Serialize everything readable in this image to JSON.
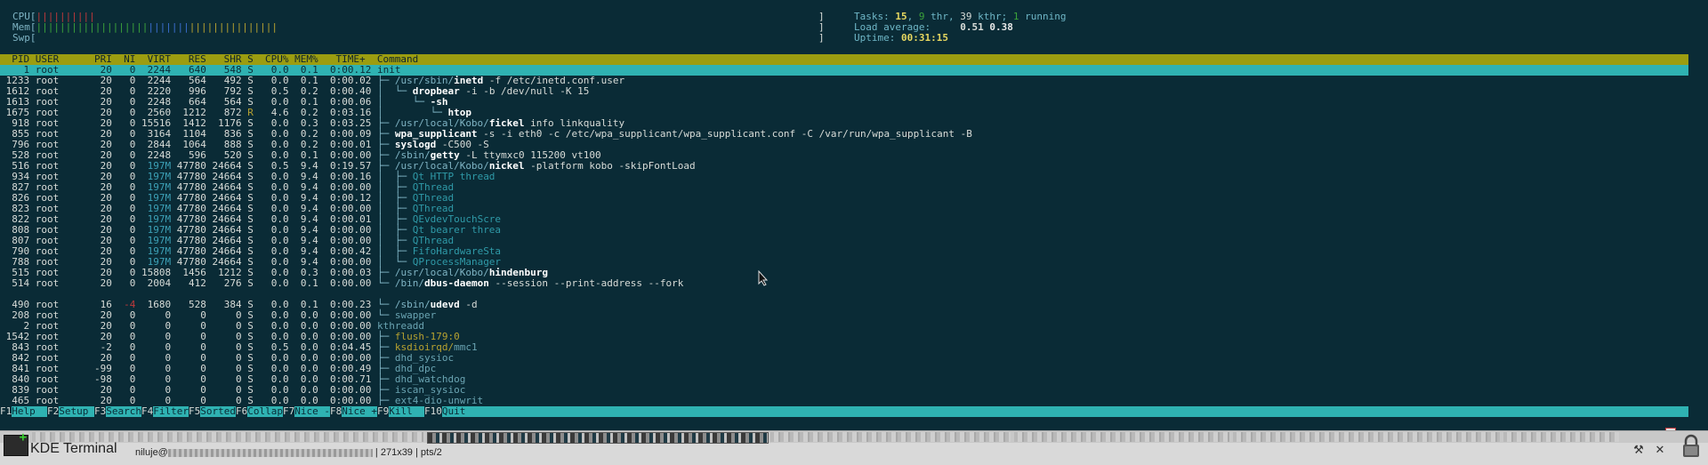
{
  "meters": {
    "cpu_label": "CPU[",
    "cpu_bars": "||||||||||",
    "cpu_close": "",
    "mem_label": "Mem[",
    "mem_bars_g": "|||||||||||||||||||",
    "mem_bars_b": "|||||||",
    "mem_bars_y": "|||||||||||||||",
    "swp_label": "Swp["
  },
  "info": {
    "tasks_label": "Tasks:",
    "tasks": "15",
    "thr": "9",
    "thr_label": "thr,",
    "kthr": "39",
    "kthr_label": "kthr;",
    "running": "1",
    "running_label": "running",
    "load_label": "Load average:",
    "load1": "0.51",
    "load5": "0.38",
    "uptime_label": "Uptime:",
    "uptime": "00:31:15"
  },
  "header": "  PID USER      PRI  NI  VIRT   RES   SHR S  CPU% MEM%   TIME+  Command",
  "processes": [
    {
      "pid": "1",
      "user": "root",
      "pri": "20",
      "ni": "0",
      "virt": "2244",
      "res": "640",
      "shr": "548",
      "s": "S",
      "cpu": "0.0",
      "mem": "0.1",
      "time": "0:00.12",
      "tree": "",
      "path": "",
      "name": "init",
      "args": "",
      "kind": "sel"
    },
    {
      "pid": "1233",
      "user": "root",
      "pri": "20",
      "ni": "0",
      "virt": "2244",
      "res": "564",
      "shr": "492",
      "s": "S",
      "cpu": "0.0",
      "mem": "0.1",
      "time": "0:00.02",
      "tree": "├─ ",
      "path": "/usr/sbin/",
      "name": "inetd",
      "args": " -f /etc/inetd.conf.user",
      "kind": "proc"
    },
    {
      "pid": "1612",
      "user": "root",
      "pri": "20",
      "ni": "0",
      "virt": "2220",
      "res": "996",
      "shr": "792",
      "s": "S",
      "cpu": "0.5",
      "mem": "0.2",
      "time": "0:00.40",
      "tree": "│  └─ ",
      "path": "",
      "name": "dropbear",
      "args": " -i -b /dev/null -K 15",
      "kind": "proc"
    },
    {
      "pid": "1613",
      "user": "root",
      "pri": "20",
      "ni": "0",
      "virt": "2248",
      "res": "664",
      "shr": "564",
      "s": "S",
      "cpu": "0.0",
      "mem": "0.1",
      "time": "0:00.06",
      "tree": "│     └─ ",
      "path": "",
      "name": "-sh",
      "args": "",
      "kind": "proc"
    },
    {
      "pid": "1675",
      "user": "root",
      "pri": "20",
      "ni": "0",
      "virt": "2560",
      "res": "1212",
      "shr": "872",
      "s": "R",
      "cpu": "4.6",
      "mem": "0.2",
      "time": "0:03.16",
      "tree": "│        └─ ",
      "path": "",
      "name": "htop",
      "args": "",
      "kind": "proc"
    },
    {
      "pid": "918",
      "user": "root",
      "pri": "20",
      "ni": "0",
      "virt": "15516",
      "res": "1412",
      "shr": "1176",
      "s": "S",
      "cpu": "0.0",
      "mem": "0.3",
      "time": "0:03.25",
      "tree": "├─ ",
      "path": "/usr/local/Kobo/",
      "name": "fickel",
      "args": " info linkquality",
      "kind": "proc"
    },
    {
      "pid": "855",
      "user": "root",
      "pri": "20",
      "ni": "0",
      "virt": "3164",
      "res": "1104",
      "shr": "836",
      "s": "S",
      "cpu": "0.0",
      "mem": "0.2",
      "time": "0:00.09",
      "tree": "├─ ",
      "path": "",
      "name": "wpa_supplicant",
      "args": " -s -i eth0 -c /etc/wpa_supplicant/wpa_supplicant.conf -C /var/run/wpa_supplicant -B",
      "kind": "proc"
    },
    {
      "pid": "796",
      "user": "root",
      "pri": "20",
      "ni": "0",
      "virt": "2844",
      "res": "1064",
      "shr": "888",
      "s": "S",
      "cpu": "0.0",
      "mem": "0.2",
      "time": "0:00.01",
      "tree": "├─ ",
      "path": "",
      "name": "syslogd",
      "args": " -C500 -S",
      "kind": "proc"
    },
    {
      "pid": "528",
      "user": "root",
      "pri": "20",
      "ni": "0",
      "virt": "2248",
      "res": "596",
      "shr": "520",
      "s": "S",
      "cpu": "0.0",
      "mem": "0.1",
      "time": "0:00.00",
      "tree": "├─ ",
      "path": "/sbin/",
      "name": "getty",
      "args": " -L ttymxc0 115200 vt100",
      "kind": "proc"
    },
    {
      "pid": "516",
      "user": "root",
      "pri": "20",
      "ni": "0",
      "virt": "197M",
      "res": "47780",
      "shr": "24664",
      "s": "S",
      "cpu": "0.5",
      "mem": "9.4",
      "time": "0:19.57",
      "tree": "├─ ",
      "path": "/usr/local/Kobo/",
      "name": "nickel",
      "args": " -platform kobo -skipFontLoad",
      "kind": "proc"
    },
    {
      "pid": "934",
      "user": "root",
      "pri": "20",
      "ni": "0",
      "virt": "197M",
      "res": "47780",
      "shr": "24664",
      "s": "S",
      "cpu": "0.0",
      "mem": "9.4",
      "time": "0:00.16",
      "tree": "│  ├─ ",
      "path": "",
      "name": "Qt HTTP thread",
      "args": "",
      "kind": "thread"
    },
    {
      "pid": "827",
      "user": "root",
      "pri": "20",
      "ni": "0",
      "virt": "197M",
      "res": "47780",
      "shr": "24664",
      "s": "S",
      "cpu": "0.0",
      "mem": "9.4",
      "time": "0:00.00",
      "tree": "│  ├─ ",
      "path": "",
      "name": "QThread",
      "args": "",
      "kind": "thread"
    },
    {
      "pid": "826",
      "user": "root",
      "pri": "20",
      "ni": "0",
      "virt": "197M",
      "res": "47780",
      "shr": "24664",
      "s": "S",
      "cpu": "0.0",
      "mem": "9.4",
      "time": "0:00.12",
      "tree": "│  ├─ ",
      "path": "",
      "name": "QThread",
      "args": "",
      "kind": "thread"
    },
    {
      "pid": "823",
      "user": "root",
      "pri": "20",
      "ni": "0",
      "virt": "197M",
      "res": "47780",
      "shr": "24664",
      "s": "S",
      "cpu": "0.0",
      "mem": "9.4",
      "time": "0:00.00",
      "tree": "│  ├─ ",
      "path": "",
      "name": "QThread",
      "args": "",
      "kind": "thread"
    },
    {
      "pid": "822",
      "user": "root",
      "pri": "20",
      "ni": "0",
      "virt": "197M",
      "res": "47780",
      "shr": "24664",
      "s": "S",
      "cpu": "0.0",
      "mem": "9.4",
      "time": "0:00.01",
      "tree": "│  ├─ ",
      "path": "",
      "name": "QEvdevTouchScre",
      "args": "",
      "kind": "thread"
    },
    {
      "pid": "808",
      "user": "root",
      "pri": "20",
      "ni": "0",
      "virt": "197M",
      "res": "47780",
      "shr": "24664",
      "s": "S",
      "cpu": "0.0",
      "mem": "9.4",
      "time": "0:00.00",
      "tree": "│  ├─ ",
      "path": "",
      "name": "Qt bearer threa",
      "args": "",
      "kind": "thread"
    },
    {
      "pid": "807",
      "user": "root",
      "pri": "20",
      "ni": "0",
      "virt": "197M",
      "res": "47780",
      "shr": "24664",
      "s": "S",
      "cpu": "0.0",
      "mem": "9.4",
      "time": "0:00.00",
      "tree": "│  ├─ ",
      "path": "",
      "name": "QThread",
      "args": "",
      "kind": "thread"
    },
    {
      "pid": "790",
      "user": "root",
      "pri": "20",
      "ni": "0",
      "virt": "197M",
      "res": "47780",
      "shr": "24664",
      "s": "S",
      "cpu": "0.0",
      "mem": "9.4",
      "time": "0:00.42",
      "tree": "│  ├─ ",
      "path": "",
      "name": "FifoHardwareSta",
      "args": "",
      "kind": "thread"
    },
    {
      "pid": "788",
      "user": "root",
      "pri": "20",
      "ni": "0",
      "virt": "197M",
      "res": "47780",
      "shr": "24664",
      "s": "S",
      "cpu": "0.0",
      "mem": "9.4",
      "time": "0:00.00",
      "tree": "│  └─ ",
      "path": "",
      "name": "QProcessManager",
      "args": "",
      "kind": "thread"
    },
    {
      "pid": "515",
      "user": "root",
      "pri": "20",
      "ni": "0",
      "virt": "15808",
      "res": "1456",
      "shr": "1212",
      "s": "S",
      "cpu": "0.0",
      "mem": "0.3",
      "time": "0:00.03",
      "tree": "├─ ",
      "path": "/usr/local/Kobo/",
      "name": "hindenburg",
      "args": "",
      "kind": "proc"
    },
    {
      "pid": "514",
      "user": "root",
      "pri": "20",
      "ni": "0",
      "virt": "2004",
      "res": "412",
      "shr": "276",
      "s": "S",
      "cpu": "0.0",
      "mem": "0.1",
      "time": "0:00.00",
      "tree": "└─ ",
      "path": "/bin/",
      "name": "dbus-daemon",
      "args": " --session --print-address --fork",
      "kind": "proc"
    },
    {
      "kind": "blank"
    },
    {
      "pid": "490",
      "user": "root",
      "pri": "16",
      "ni": "-4",
      "virt": "1680",
      "res": "528",
      "shr": "384",
      "s": "S",
      "cpu": "0.0",
      "mem": "0.1",
      "time": "0:00.23",
      "tree": "└─ ",
      "path": "/sbin/",
      "name": "udevd",
      "args": " -d",
      "kind": "proc"
    },
    {
      "pid": "208",
      "user": "root",
      "pri": "20",
      "ni": "0",
      "virt": "0",
      "res": "0",
      "shr": "0",
      "s": "S",
      "cpu": "0.0",
      "mem": "0.0",
      "time": "0:00.00",
      "tree": "└─ ",
      "path": "",
      "name": "swapper",
      "args": "",
      "kind": "kthread"
    },
    {
      "pid": "2",
      "user": "root",
      "pri": "20",
      "ni": "0",
      "virt": "0",
      "res": "0",
      "shr": "0",
      "s": "S",
      "cpu": "0.0",
      "mem": "0.0",
      "time": "0:00.00",
      "tree": "",
      "path": "",
      "name": "kthreadd",
      "args": "",
      "kind": "kthread"
    },
    {
      "pid": "1542",
      "user": "root",
      "pri": "20",
      "ni": "0",
      "virt": "0",
      "res": "0",
      "shr": "0",
      "s": "S",
      "cpu": "0.0",
      "mem": "0.0",
      "time": "0:00.00",
      "tree": "├─ ",
      "path": "",
      "name": "flush-179:0",
      "args": "",
      "kind": "kyellow"
    },
    {
      "pid": "843",
      "user": "root",
      "pri": "-2",
      "ni": "0",
      "virt": "0",
      "res": "0",
      "shr": "0",
      "s": "S",
      "cpu": "0.5",
      "mem": "0.0",
      "time": "0:04.45",
      "tree": "├─ ",
      "path": "",
      "name": "ksdioirqd/",
      "args": "mmc1",
      "kind": "kyellow"
    },
    {
      "pid": "842",
      "user": "root",
      "pri": "20",
      "ni": "0",
      "virt": "0",
      "res": "0",
      "shr": "0",
      "s": "S",
      "cpu": "0.0",
      "mem": "0.0",
      "time": "0:00.00",
      "tree": "├─ ",
      "path": "",
      "name": "dhd_sysioc",
      "args": "",
      "kind": "kthread"
    },
    {
      "pid": "841",
      "user": "root",
      "pri": "-99",
      "ni": "0",
      "virt": "0",
      "res": "0",
      "shr": "0",
      "s": "S",
      "cpu": "0.0",
      "mem": "0.0",
      "time": "0:00.49",
      "tree": "├─ ",
      "path": "",
      "name": "dhd_dpc",
      "args": "",
      "kind": "kthread"
    },
    {
      "pid": "840",
      "user": "root",
      "pri": "-98",
      "ni": "0",
      "virt": "0",
      "res": "0",
      "shr": "0",
      "s": "S",
      "cpu": "0.0",
      "mem": "0.0",
      "time": "0:00.71",
      "tree": "├─ ",
      "path": "",
      "name": "dhd_watchdog",
      "args": "",
      "kind": "kthread"
    },
    {
      "pid": "839",
      "user": "root",
      "pri": "20",
      "ni": "0",
      "virt": "0",
      "res": "0",
      "shr": "0",
      "s": "S",
      "cpu": "0.0",
      "mem": "0.0",
      "time": "0:00.00",
      "tree": "├─ ",
      "path": "",
      "name": "iscan_sysioc",
      "args": "",
      "kind": "kthread"
    },
    {
      "pid": "465",
      "user": "root",
      "pri": "20",
      "ni": "0",
      "virt": "0",
      "res": "0",
      "shr": "0",
      "s": "S",
      "cpu": "0.0",
      "mem": "0.0",
      "time": "0:00.00",
      "tree": "├─ ",
      "path": "",
      "name": "ext4-dio-unwrit",
      "args": "",
      "kind": "kthread"
    }
  ],
  "fkeys": [
    {
      "key": "F1",
      "label": "Help  "
    },
    {
      "key": "F2",
      "label": "Setup "
    },
    {
      "key": "F3",
      "label": "Search"
    },
    {
      "key": "F4",
      "label": "Filter"
    },
    {
      "key": "F5",
      "label": "Sorted"
    },
    {
      "key": "F6",
      "label": "Collap"
    },
    {
      "key": "F7",
      "label": "Nice -"
    },
    {
      "key": "F8",
      "label": "Nice +"
    },
    {
      "key": "F9",
      "label": "Kill  "
    },
    {
      "key": "F10",
      "label": "Quit"
    }
  ],
  "taskbar": {
    "app_title": "KDE Terminal",
    "user_prefix": "niluje@",
    "size": "| 271x39 | pts/2"
  },
  "colors": {
    "terminal_bg": "#0a2b36",
    "header_bg": "#9c9d10",
    "selection_bg": "#2fb2b2",
    "fkey_bar_bg": "#2fb2b2",
    "taskbar_bg": "#d9d9d9"
  },
  "icons": {
    "app": "terminal-icon",
    "tray1": "tools-icon",
    "tray2": "close-icon",
    "tray3": "lock-icon",
    "cursor": "mouse-pointer-icon"
  }
}
